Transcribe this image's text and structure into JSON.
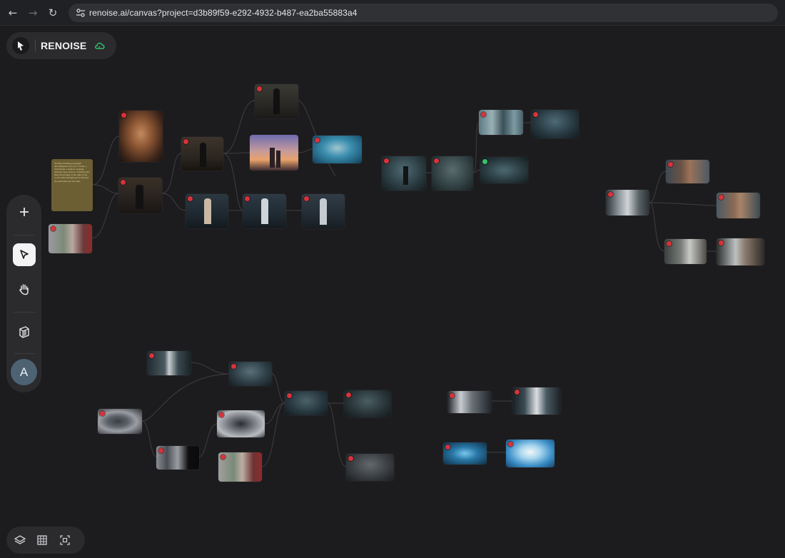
{
  "browser": {
    "url": "renoise.ai/canvas?project=d3b89f59-e292-4932-b487-ea2ba55883a4",
    "back_icon": "←",
    "forward_icon": "→",
    "reload_icon": "↻"
  },
  "brand": {
    "name": "RENOISE",
    "sync_icon": "cloud-sync-icon",
    "sync_color": "#2fbf6a"
  },
  "toolbar": {
    "items": [
      "add-icon",
      "pointer-icon",
      "hand-icon",
      "assets-icon"
    ],
    "active": "pointer-icon",
    "avatar_initial": "A"
  },
  "bottom_bar": {
    "items": [
      "layers-icon",
      "grid-icon",
      "fit-view-icon"
    ]
  },
  "text_node": {
    "text": "Narrative framing paragraph describing the story arc: a forest, a cursed land, a shadow creeping between trees, and two travellers who meet the stranger at the edge of the world while the light grows dim and the path fades into the dark."
  },
  "colors": {
    "canvas_bg": "#1c1b1d",
    "panel_bg": "#2b2a2d",
    "status_red": "#d9323a",
    "status_green": "#36c26a",
    "text_card": "#6b5f33"
  }
}
